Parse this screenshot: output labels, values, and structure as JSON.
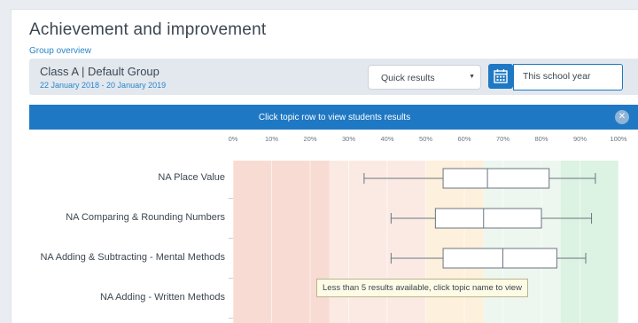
{
  "page": {
    "title": "Achievement and improvement",
    "subtitle": "Group overview"
  },
  "group": {
    "name": "Class A | Default Group",
    "dates": "22 January 2018 - 20 January 2019",
    "quick_results": "Quick results",
    "period": "This school year"
  },
  "banner": {
    "text": "Click topic row to view students results",
    "close_icon": "close-icon"
  },
  "tooltip": "Less than 5 results available, click topic name to view",
  "colors": {
    "band_red": "#f8dcd3",
    "band_light_red": "#fbeae4",
    "band_orange": "#fdf0dc",
    "band_light_green": "#edf7ef",
    "band_green": "#dcf2e2",
    "accent": "#1f78c3"
  },
  "chart_data": {
    "type": "boxplot",
    "orientation": "horizontal",
    "x_ticks": [
      "0%",
      "10%",
      "20%",
      "30%",
      "40%",
      "50%",
      "60%",
      "70%",
      "80%",
      "90%",
      "100%"
    ],
    "xlim": [
      0,
      100
    ],
    "bands": [
      {
        "from": 0,
        "to": 25,
        "color": "band_red"
      },
      {
        "from": 25,
        "to": 50,
        "color": "band_light_red"
      },
      {
        "from": 50,
        "to": 65,
        "color": "band_orange"
      },
      {
        "from": 65,
        "to": 85,
        "color": "band_light_green"
      },
      {
        "from": 85,
        "to": 100,
        "color": "band_green"
      }
    ],
    "categories": [
      "NA Place Value",
      "NA Comparing & Rounding Numbers",
      "NA Adding & Subtracting - Mental Methods",
      "NA Adding - Written Methods"
    ],
    "boxes": [
      {
        "min": 34,
        "q1": 54.5,
        "median": 66,
        "q3": 82,
        "max": 94
      },
      {
        "min": 41,
        "q1": 52.5,
        "median": 65,
        "q3": 80,
        "max": 93
      },
      {
        "min": 41,
        "q1": 54.5,
        "median": 70,
        "q3": 84,
        "max": 91.5
      },
      null
    ]
  }
}
